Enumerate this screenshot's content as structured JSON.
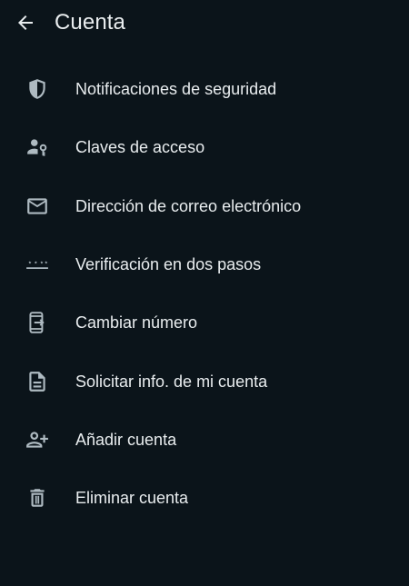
{
  "header": {
    "title": "Cuenta",
    "back_icon": "arrow-back-icon"
  },
  "colors": {
    "background": "#0b141a",
    "text": "#e9edef",
    "icon": "#aebac1"
  },
  "menu": {
    "items": [
      {
        "label": "Notificaciones de seguridad",
        "icon": "shield-icon"
      },
      {
        "label": "Claves de acceso",
        "icon": "person-key-icon"
      },
      {
        "label": "Dirección de correo electrónico",
        "icon": "mail-icon"
      },
      {
        "label": "Verificación en dos pasos",
        "icon": "password-dots-icon"
      },
      {
        "label": "Cambiar número",
        "icon": "phone-change-icon"
      },
      {
        "label": "Solicitar info. de mi cuenta",
        "icon": "document-icon"
      },
      {
        "label": "Añadir cuenta",
        "icon": "person-add-icon"
      },
      {
        "label": "Eliminar cuenta",
        "icon": "trash-icon"
      }
    ]
  }
}
